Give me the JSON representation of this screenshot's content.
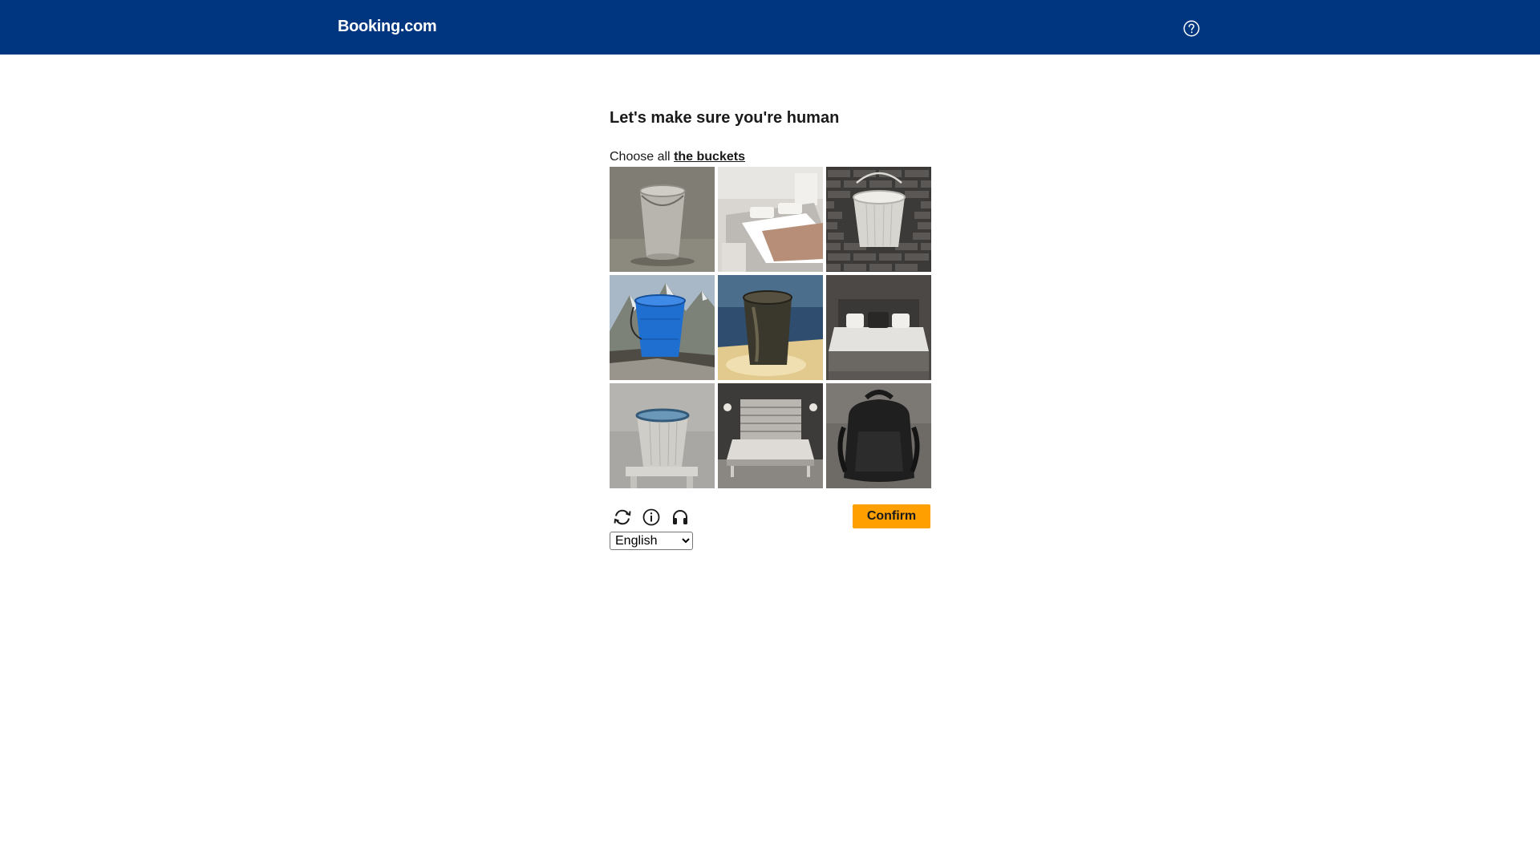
{
  "header": {
    "logo": "Booking.com",
    "help_icon": "help-circle-icon",
    "background": "#003580"
  },
  "captcha": {
    "heading": "Let's make sure you're human",
    "prompt_prefix": "Choose all",
    "prompt_target": "the buckets",
    "tiles": [
      {
        "subject": "metal bucket"
      },
      {
        "subject": "bed"
      },
      {
        "subject": "metal bucket on brick wall"
      },
      {
        "subject": "blue bucket on mountain"
      },
      {
        "subject": "dark bucket by water"
      },
      {
        "subject": "bed"
      },
      {
        "subject": "metal bucket on chair"
      },
      {
        "subject": "bed"
      },
      {
        "subject": "black backpack"
      }
    ],
    "controls": {
      "refresh_icon": "refresh-icon",
      "info_icon": "info-icon",
      "audio_icon": "headphones-icon",
      "confirm_label": "Confirm",
      "confirm_color": "#ffa000"
    },
    "language": {
      "selected": "English"
    }
  }
}
